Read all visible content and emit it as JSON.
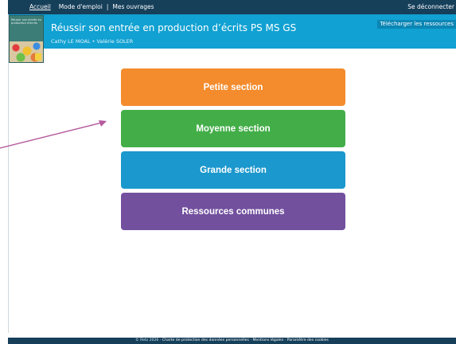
{
  "nav": {
    "home": "Accueil",
    "guide": "Mode d'emploi",
    "separator": "|",
    "my_books": "Mes ouvrages",
    "logout": "Se déconnecter"
  },
  "header": {
    "title": "Réussir son entrée en production d’écrits PS MS GS",
    "authors": "Cathy LE MOAL • Valérie SOLER",
    "download": "Télécharger les ressources",
    "cover_text": "Réussir son entrée en production d'écrits"
  },
  "sections": [
    {
      "label": "Petite section",
      "color": "#f48b2c"
    },
    {
      "label": "Moyenne section",
      "color": "#43ae48"
    },
    {
      "label": "Grande section",
      "color": "#1b98cd"
    },
    {
      "label": "Ressources communes",
      "color": "#72509e"
    }
  ],
  "footer": {
    "copyright": "© Retz 2026 -",
    "privacy": "Charte de protection des données personnelles",
    "legal": "Mentions légales",
    "cookies": "Paramètre des cookies",
    "dash": "-"
  },
  "annotation": {
    "arrow_color": "#b65a9e"
  }
}
